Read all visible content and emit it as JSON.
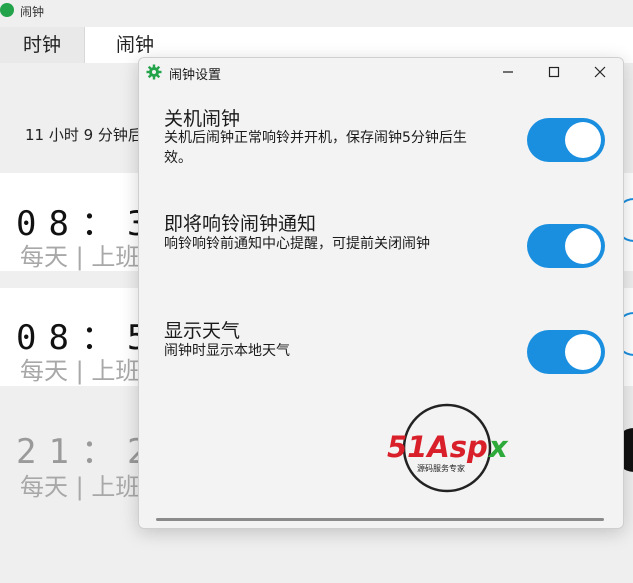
{
  "main_window": {
    "title": "闹钟",
    "tabs": [
      {
        "label": "时钟"
      },
      {
        "label": "闹钟"
      }
    ],
    "countdown_text": "11 小时 9 分钟后",
    "alarms": [
      {
        "time": "08：3",
        "repeat": "每天 | 上班",
        "enabled": true
      },
      {
        "time": "08：5",
        "repeat": "每天 | 上班",
        "enabled": true
      },
      {
        "time": "21：2",
        "repeat": "每天 | 上班",
        "enabled": false
      }
    ]
  },
  "dialog": {
    "title": "闹钟设置",
    "icon": "gear-icon",
    "settings": [
      {
        "title": "关机闹钟",
        "description": "关机后闹钟正常响铃并开机，保存闹钟5分钟后生效。",
        "enabled": true
      },
      {
        "title": "即将响铃闹钟通知",
        "description": "响铃响铃前通知中心提醒，可提前关闭闹钟",
        "enabled": true
      },
      {
        "title": "显示天气",
        "description": "闹钟时显示本地天气",
        "enabled": true
      }
    ],
    "logo": {
      "brand": "51Aspx",
      "tagline": "源码服务专家"
    }
  },
  "colors": {
    "accent": "#1a8fe0",
    "logo_red": "#d9202a",
    "logo_green": "#2eaa3a"
  }
}
